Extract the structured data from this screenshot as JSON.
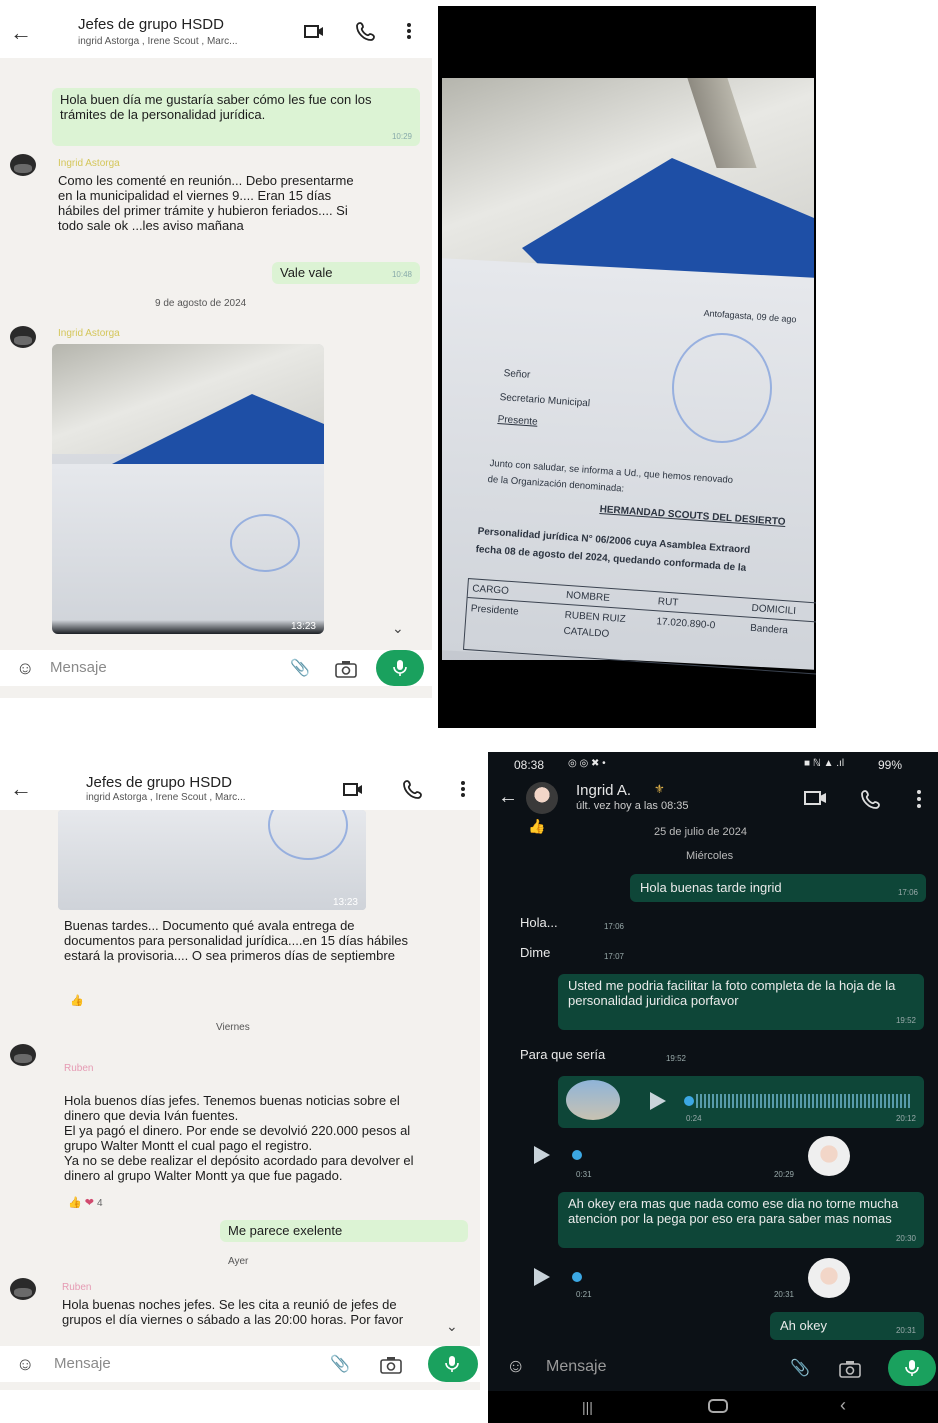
{
  "chat": {
    "title": "Jefes de grupo HSDD",
    "members": "ingrid Astorga , Irene Scout , Marc...",
    "input_placeholder": "Mensaje"
  },
  "panel1": {
    "msg1": "Hola buen día me gustaría saber cómo les fue con los trámites de la personalidad jurídica.",
    "msg1_time": "10:29",
    "sender1": "Ingrid Astorga",
    "msg2": "Como les comenté en reunión... Debo presentarme en la municipalidad el viernes 9.... Eran 15 días hábiles del primer trámite y hubieron feriados.... Si todo sale ok ...les aviso mañana",
    "msg3": "Vale vale",
    "msg3_time": "10:48",
    "date_chip": "9 de agosto de 2024",
    "sender2": "Ingrid Astorga",
    "image_time": "13:23"
  },
  "document": {
    "city_date": "Antofagasta, 09 de ago",
    "line1": "Señor",
    "line2": "Secretario Municipal",
    "line3": "Presente",
    "body1": "Junto con saludar, se informa a Ud., que hemos renovado",
    "body2": "de la Organización denominada:",
    "org": "HERMANDAD SCOUTS DEL DESIERTO",
    "body3": "Personalidad jurídica N° 06/2006 cuya Asamblea Extraord",
    "body4": "fecha 08 de agosto del 2024, quedando conformada de la",
    "table_head": [
      "CARGO",
      "NOMBRE",
      "RUT",
      "DOMICILI"
    ],
    "table_row": [
      "Presidente",
      "RUBEN RUIZ",
      "17.020.890-0",
      "Bandera"
    ],
    "table_row2": "CATALDO"
  },
  "panel3": {
    "msg1": "Buenas tardes... Documento qué avala entrega de documentos para personalidad jurídica....en 15 días hábiles estará la provisoria.... O sea primeros días de septiembre",
    "day_chip": "Viernes",
    "sender": "Ruben",
    "msg2": "Hola buenos días jefes. Tenemos buenas noticias sobre el dinero que devia Iván fuentes.\nEl ya pagó el dinero. Por ende se devolvió 220.000 pesos al grupo Walter Montt el cual pago el registro.\nYa no se debe realizar el depósito acordado para devolver el dinero al grupo Walter Montt ya que fue pagado.",
    "reactions_count": "4",
    "msg3": "Me parece exelente",
    "day_chip2": "Ayer",
    "sender2": "Ruben",
    "msg4": "Hola buenas noches jefes. Se les cita a reunió de jefes de grupos el día viernes o sábado a las 20:00 horas. Por favor"
  },
  "panel4": {
    "status_time": "08:38",
    "battery": "99%",
    "contact": "Ingrid A.",
    "last_seen": "últ. vez hoy a las 08:35",
    "date_chip": "25 de julio de 2024",
    "day_chip": "Miércoles",
    "msg1": "Hola buenas tarde ingrid",
    "msg1_time": "17:06",
    "msg2": "Hola...",
    "msg2_time": "17:06",
    "msg3": "Dime",
    "msg3_time": "17:07",
    "msg4": "Usted me podria facilitar la foto completa de la hoja de la personalidad juridica porfavor",
    "msg4_time": "19:52",
    "msg5": "Para que sería",
    "msg5_time": "19:52",
    "voice1_len": "0:24",
    "voice1_time": "20:12",
    "voice2_len": "0:31",
    "voice2_time": "20:29",
    "msg6": "Ah okey era mas que nada como ese dia no torne mucha atencion por la pega por eso era para saber mas nomas",
    "msg6_time": "20:30",
    "voice3_len": "0:21",
    "voice3_time": "20:31",
    "msg7": "Ah okey",
    "msg7_time": "20:31",
    "input_placeholder": "Mensaje"
  }
}
